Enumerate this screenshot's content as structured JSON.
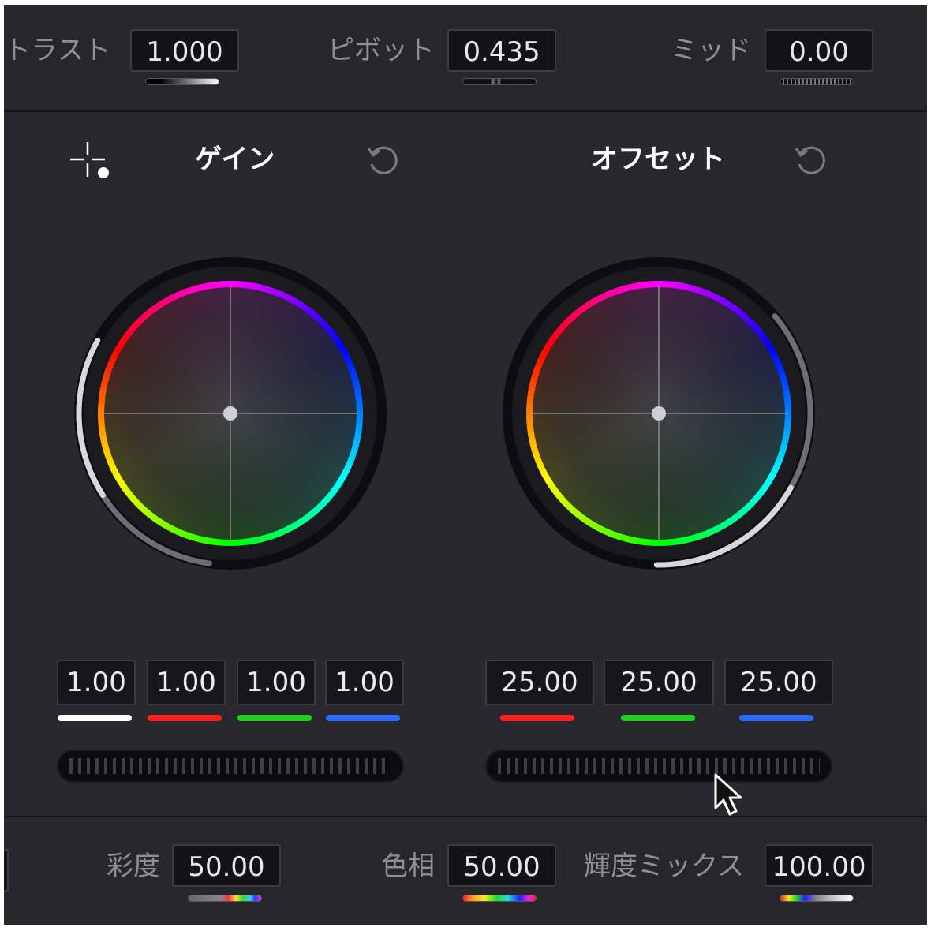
{
  "top_bar": {
    "contrast": {
      "label": "トラスト",
      "value": "1.000"
    },
    "pivot": {
      "label": "ピボット",
      "value": "0.435"
    },
    "mid": {
      "label": "ミッド",
      "value": "0.00"
    }
  },
  "wheels": [
    {
      "title": "ゲイン",
      "channels": [
        {
          "value": "1.00",
          "color": "#ffffff"
        },
        {
          "value": "1.00",
          "color": "#ff2020"
        },
        {
          "value": "1.00",
          "color": "#20d020"
        },
        {
          "value": "1.00",
          "color": "#2a6cff"
        }
      ]
    },
    {
      "title": "オフセット",
      "channels": [
        {
          "value": "25.00",
          "color": "#ff2020"
        },
        {
          "value": "25.00",
          "color": "#20d020"
        },
        {
          "value": "25.00",
          "color": "#2a6cff"
        }
      ]
    }
  ],
  "bottom_bar": {
    "saturation": {
      "label": "彩度",
      "value": "50.00"
    },
    "hue": {
      "label": "色相",
      "value": "50.00"
    },
    "lum_mix": {
      "label": "輝度ミックス",
      "value": "100.00"
    }
  },
  "icons": {
    "picker": "crosshair-dot-icon",
    "reset": "reset-arrow-icon",
    "cursor": "mouse-pointer-icon"
  }
}
